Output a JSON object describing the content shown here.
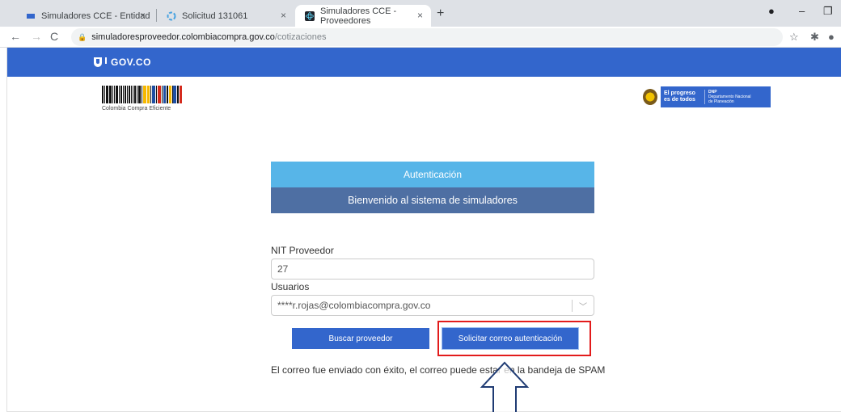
{
  "browser": {
    "tabs": [
      {
        "title": "Simuladores CCE - Entidad",
        "icon": "cce-favicon",
        "active": false
      },
      {
        "title": "Solicitud 131061",
        "icon": "loading-favicon",
        "active": false
      },
      {
        "title": "Simuladores CCE - Proveedores",
        "icon": "react-favicon",
        "active": true
      }
    ],
    "close_glyph": "×",
    "new_tab_glyph": "+",
    "url_host": "simuladoresproveedor.colombiacompra.gov.co",
    "url_path": "/cotizaciones"
  },
  "header": {
    "gov_logo_text": "GOV.CO",
    "gov_color": "#3366cc",
    "cce_logo_caption": "Colombia Compra Eficiente",
    "dnp_slogan": "El progreso es de todos",
    "dnp_abbr": "DNP",
    "dnp_name": "Departamento Nacional de Planeación"
  },
  "auth": {
    "title": "Autenticación",
    "subtitle": "Bienvenido al sistema de simuladores",
    "nit_label": "NIT Proveedor",
    "nit_value": "27",
    "users_label": "Usuarios",
    "users_value": "****r.rojas@colombiacompra.gov.co",
    "search_button": "Buscar proveedor",
    "request_button": "Solicitar correo autenticación",
    "message": "El correo fue enviado con éxito, el correo puede estar en la bandeja de SPAM"
  },
  "colors": {
    "panel_header": "#57b5e8",
    "panel_sub": "#4e6fa3",
    "button": "#3366cc",
    "highlight": "#e21b1b",
    "arrow": "#1f3b73"
  }
}
